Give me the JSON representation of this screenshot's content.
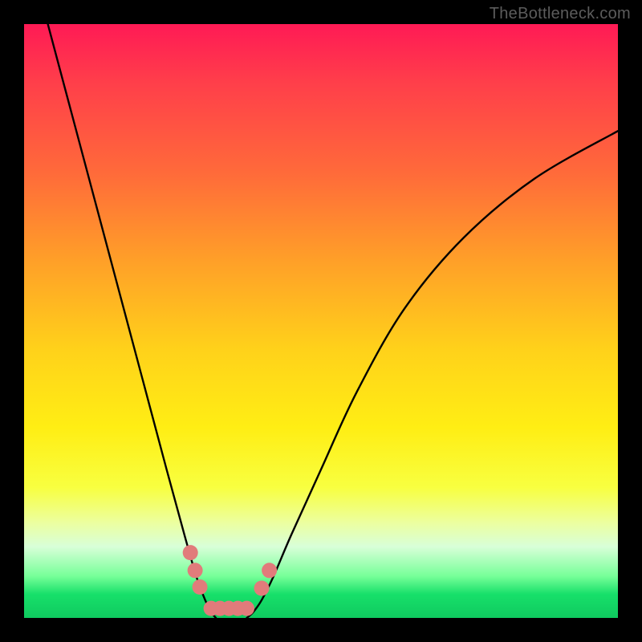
{
  "watermark": "TheBottleneck.com",
  "chart_data": {
    "type": "line",
    "title": "",
    "xlabel": "",
    "ylabel": "",
    "xlim": [
      0,
      100
    ],
    "ylim": [
      0,
      100
    ],
    "series": [
      {
        "name": "curve-left",
        "x": [
          4,
          8,
          12,
          16,
          20,
          24,
          27,
          29,
          30.5,
          31.5,
          32.3
        ],
        "y": [
          100,
          85,
          70,
          55,
          40,
          25,
          14,
          7,
          3,
          1,
          0
        ]
      },
      {
        "name": "curve-right",
        "x": [
          37.5,
          38.6,
          40,
          42,
          45,
          50,
          56,
          64,
          74,
          86,
          100
        ],
        "y": [
          0,
          1,
          3,
          7,
          14,
          25,
          38,
          52,
          64,
          74,
          82
        ]
      }
    ],
    "markers": {
      "name": "data-points",
      "color": "#e17b7b",
      "points": [
        {
          "x": 28.0,
          "y": 11.0
        },
        {
          "x": 28.8,
          "y": 8.0
        },
        {
          "x": 29.6,
          "y": 5.2
        },
        {
          "x": 31.5,
          "y": 1.6
        },
        {
          "x": 33.0,
          "y": 1.6
        },
        {
          "x": 34.5,
          "y": 1.6
        },
        {
          "x": 36.0,
          "y": 1.6
        },
        {
          "x": 37.5,
          "y": 1.6
        },
        {
          "x": 40.0,
          "y": 5.0
        },
        {
          "x": 41.3,
          "y": 8.0
        }
      ]
    },
    "background_gradient": {
      "top": "#ff1a55",
      "mid": "#ffee14",
      "bottom": "#17e06a"
    }
  }
}
